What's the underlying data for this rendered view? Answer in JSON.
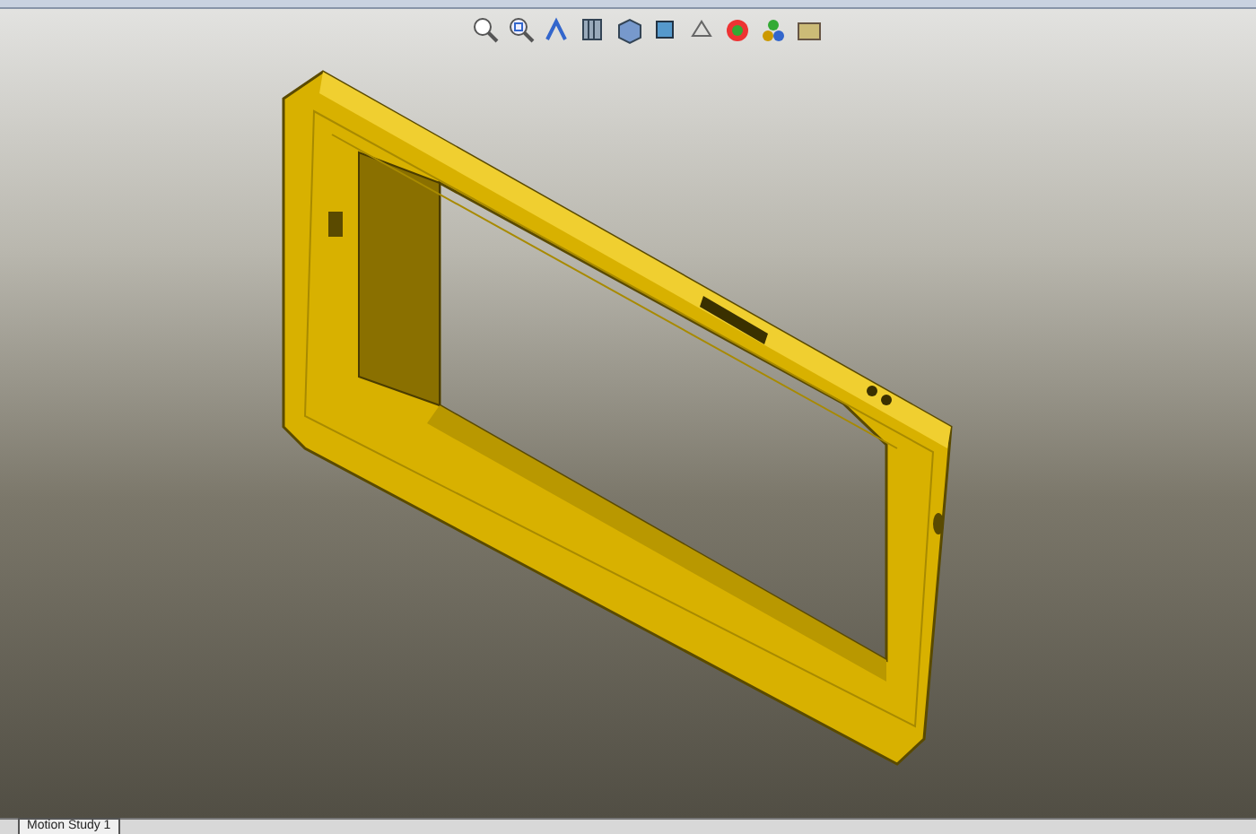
{
  "tabs": [
    {
      "label": "Motion Study 1",
      "selected": true
    }
  ]
}
